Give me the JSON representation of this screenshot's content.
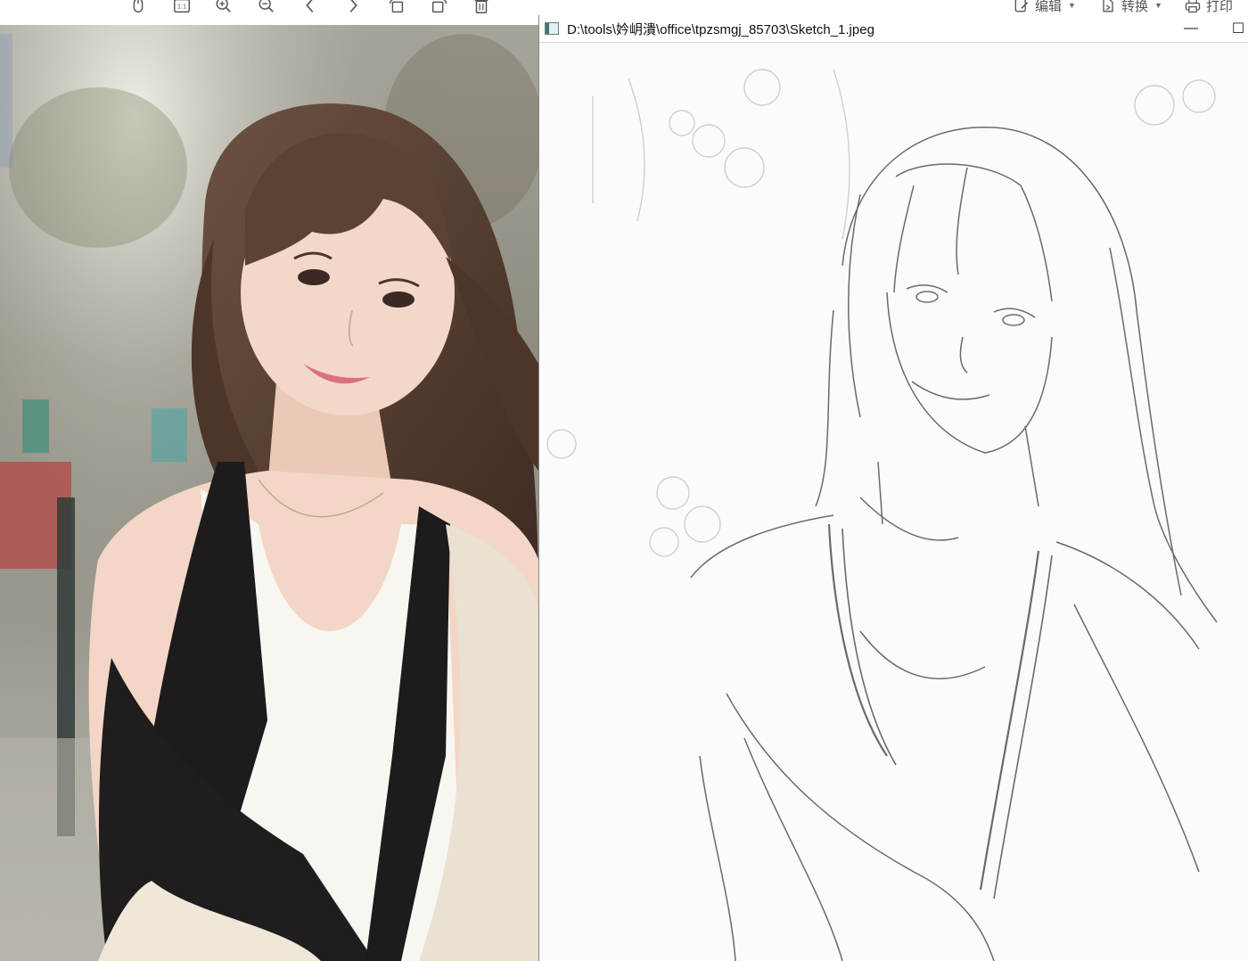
{
  "toolbar": {
    "icons": [
      "mouse-icon",
      "actual-size-icon",
      "zoom-in-icon",
      "zoom-out-icon",
      "previous-icon",
      "next-icon",
      "rotate-left-icon",
      "rotate-right-icon",
      "delete-icon"
    ],
    "actual_size_label": "1:1",
    "edit_label": "编辑",
    "convert_label": "转换",
    "print_label": "打印"
  },
  "sketch_window": {
    "title": "D:\\tools\\妗岄潰\\office\\tpzsmgj_85703\\Sketch_1.jpeg",
    "minimize_glyph": "—",
    "maximize_glyph": "☐"
  },
  "photo": {
    "subject": "portrait-photo",
    "colors": {
      "hair": "#5a4032",
      "skin": "#f3d6c6",
      "top": "#f8f6f1",
      "cardigan": "#1d1b1c",
      "skirt": "#efe8d8"
    }
  },
  "sketch": {
    "subject": "pencil-sketch",
    "line_color": "#6a6a6a"
  }
}
